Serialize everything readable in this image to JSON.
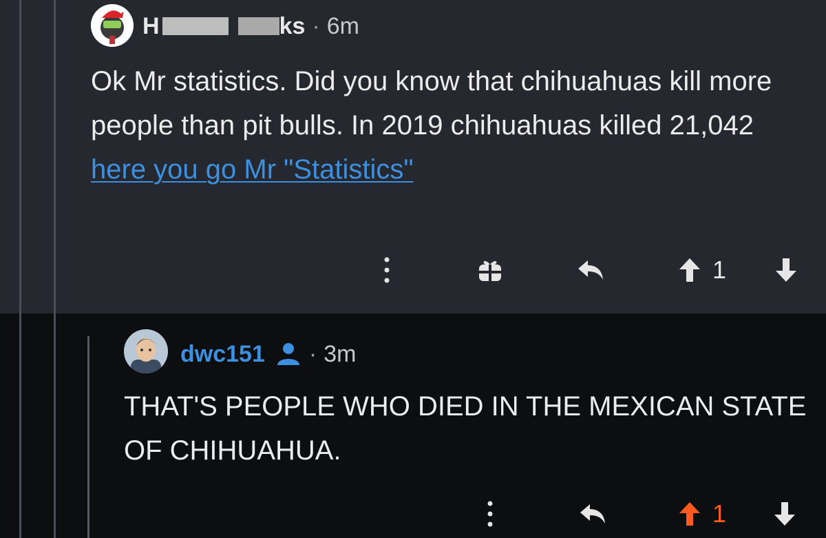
{
  "parent_comment": {
    "username_visible_start": "H",
    "username_visible_end": "ks",
    "separator": "·",
    "age": "6m",
    "body_text": "Ok Mr statistics. Did you know that chihuahuas kill more people than pit bulls. In 2019 chihuahuas killed 21,042 ",
    "link_text": "here you go Mr \"Statistics\"",
    "vote_count": "1",
    "icons": {
      "avatar": "avatar-icon",
      "more": "more-vertical-icon",
      "gift": "gift-icon",
      "reply": "reply-arrow-icon",
      "upvote": "upvote-arrow-icon",
      "downvote": "downvote-arrow-icon"
    }
  },
  "reply_comment": {
    "username": "dwc151",
    "separator": "·",
    "age": "3m",
    "body_text": "THAT'S PEOPLE WHO DIED IN THE MEXICAN STATE OF CHIHUAHUA.",
    "vote_count": "1",
    "icons": {
      "avatar": "avatar-icon",
      "user_badge": "user-badge-icon",
      "more": "more-vertical-icon",
      "reply": "reply-arrow-icon",
      "upvote": "upvote-arrow-icon",
      "downvote": "downvote-arrow-icon"
    }
  },
  "colors": {
    "highlight_background": "#25292f",
    "page_background": "#0d0e10",
    "link": "#3d8fe0",
    "upvote_active": "#ff5a1f",
    "text": "#ececec"
  }
}
